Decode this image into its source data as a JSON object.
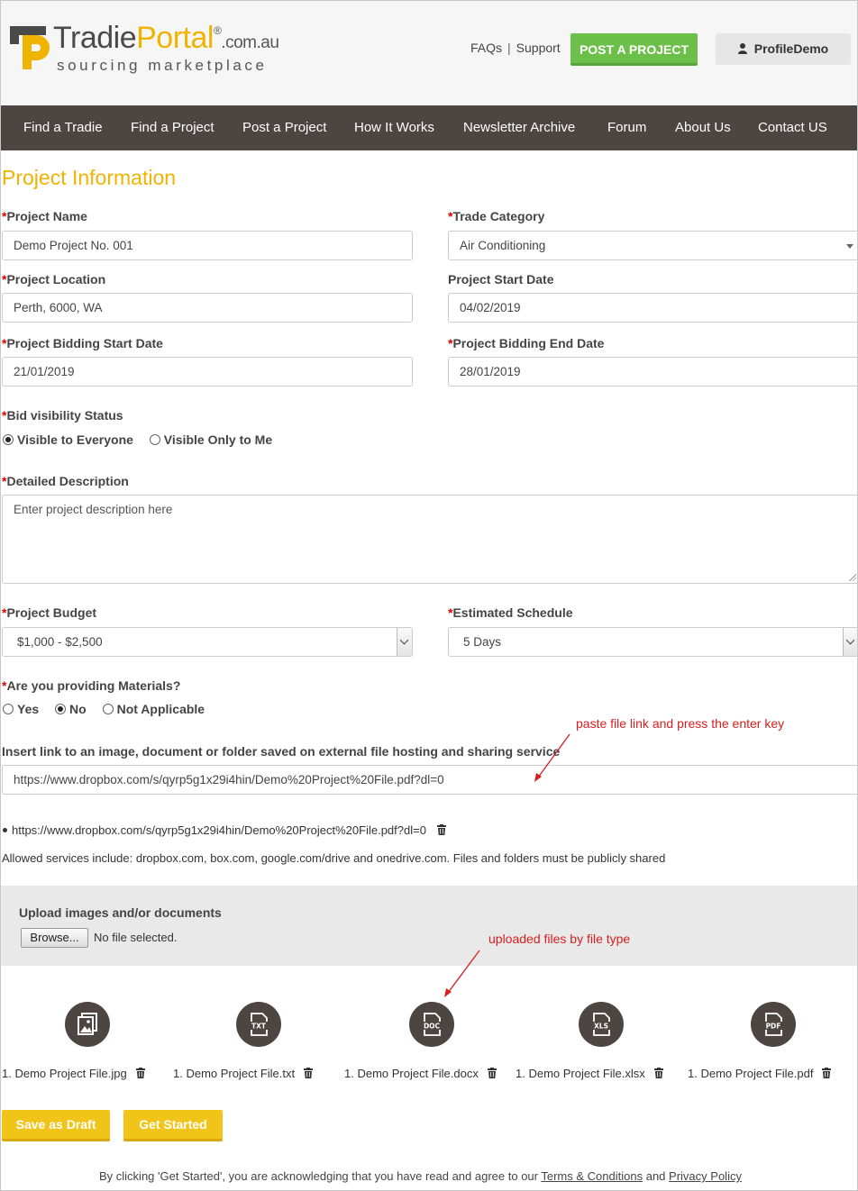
{
  "header": {
    "logo": {
      "tradie": "Tradie",
      "portal": "Portal",
      "reg": "®",
      "domain": ".com.au",
      "tagline": "sourcing marketplace"
    },
    "links": {
      "faqs": "FAQs",
      "separator": "|",
      "support": "Support"
    },
    "post_project_label": "POST A PROJECT",
    "profile_label": "ProfileDemo",
    "colors": {
      "accent": "#f0b400",
      "green": "#6cc04a",
      "nav_bg": "#4c4541"
    }
  },
  "nav": {
    "items": [
      "Find a Tradie",
      "Find a Project",
      "Post a Project",
      "How It Works",
      "Newsletter Archive",
      "Forum",
      "About Us",
      "Contact US"
    ]
  },
  "form": {
    "section_title": "Project Information",
    "required_mark": "*",
    "project_name": {
      "label": "Project Name",
      "value": "Demo Project No. 001"
    },
    "trade_category": {
      "label": "Trade Category",
      "value": "Air Conditioning"
    },
    "project_location": {
      "label": "Project Location",
      "value": "Perth, 6000, WA"
    },
    "project_start_date": {
      "label": "Project Start Date",
      "value": "04/02/2019"
    },
    "bidding_start_date": {
      "label": "Project Bidding Start Date",
      "value": "21/01/2019"
    },
    "bidding_end_date": {
      "label": "Project Bidding End Date",
      "value": "28/01/2019"
    },
    "bid_visibility": {
      "label": "Bid visibility Status",
      "options": [
        "Visible to Everyone",
        "Visible Only to Me"
      ],
      "selected": "Visible to Everyone"
    },
    "description": {
      "label": "Detailed Description",
      "placeholder": "Enter project description here"
    },
    "budget": {
      "label": "Project Budget",
      "value": "$1,000 - $2,500"
    },
    "schedule": {
      "label": "Estimated Schedule",
      "value": "5 Days"
    },
    "materials": {
      "label": "Are you providing Materials?",
      "options": [
        "Yes",
        "No",
        "Not Applicable"
      ],
      "selected": "No"
    },
    "external_link": {
      "label": "Insert link to an image, document or folder saved on external file hosting and sharing service",
      "value": "https://www.dropbox.com/s/qyrp5g1x29i4hin/Demo%20Project%20File.pdf?dl=0"
    },
    "added_links": [
      "https://www.dropbox.com/s/qyrp5g1x29i4hin/Demo%20Project%20File.pdf?dl=0"
    ],
    "allowed_services": "Allowed services include: dropbox.com, box.com, google.com/drive and onedrive.com. Files and folders must be publicly shared"
  },
  "upload": {
    "title": "Upload images and/or documents",
    "browse_label": "Browse...",
    "status": "No file selected."
  },
  "files": [
    {
      "icon": "image-file-icon",
      "badge": "",
      "name": "1. Demo Project File.jpg"
    },
    {
      "icon": "txt-file-icon",
      "badge": "TXT",
      "name": "1. Demo Project File.txt"
    },
    {
      "icon": "doc-file-icon",
      "badge": "DOC",
      "name": "1. Demo Project File.docx"
    },
    {
      "icon": "xls-file-icon",
      "badge": "XLS",
      "name": "1. Demo Project File.xlsx"
    },
    {
      "icon": "pdf-file-icon",
      "badge": "PDF",
      "name": "1. Demo Project File.pdf"
    }
  ],
  "annotations": {
    "link_hint": "paste file link and press the enter key",
    "files_hint": "uploaded files by file type",
    "color": "#d81e1e"
  },
  "actions": {
    "save_draft": "Save as Draft",
    "get_started": "Get Started"
  },
  "footer": {
    "prefix": "By clicking 'Get Started', you are acknowledging that you have read and agree to our",
    "terms": "Terms & Conditions",
    "and": "and",
    "privacy": "Privacy Policy"
  }
}
